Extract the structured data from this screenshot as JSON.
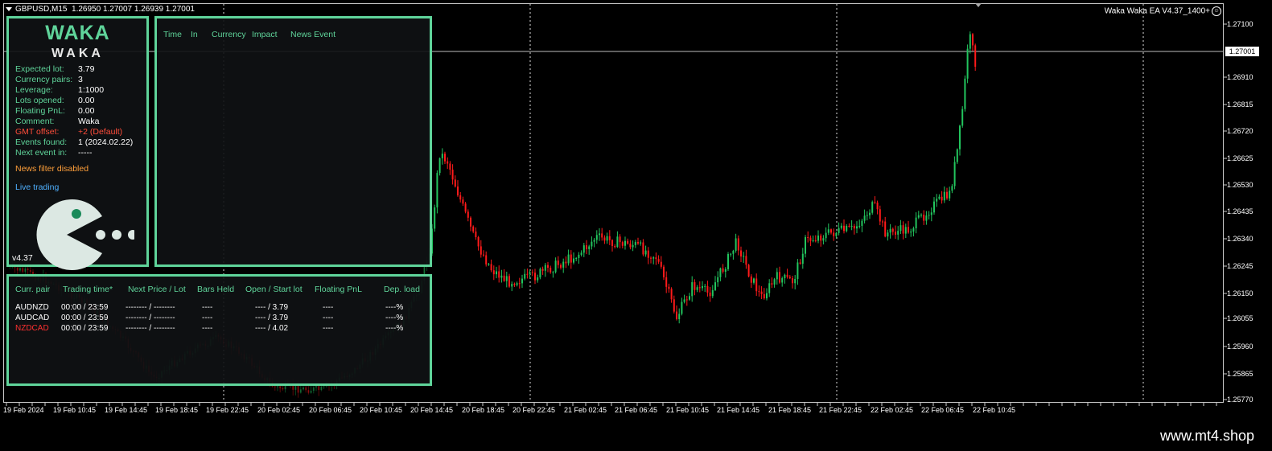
{
  "symbol_header": {
    "symbol": "GBPUSD,M15",
    "quotes": "1.26950 1.27007 1.26939 1.27001"
  },
  "ea_label": "Waka Waka EA V4.37_1400+",
  "current_price": "1.27001",
  "price_axis": [
    "1.27100",
    "1.26910",
    "1.26815",
    "1.26720",
    "1.26625",
    "1.26530",
    "1.26435",
    "1.26340",
    "1.26245",
    "1.26150",
    "1.26055",
    "1.25960",
    "1.25865",
    "1.25770"
  ],
  "time_axis": [
    "19 Feb 2024",
    "19 Feb 10:45",
    "19 Feb 14:45",
    "19 Feb 18:45",
    "19 Feb 22:45",
    "20 Feb 02:45",
    "20 Feb 06:45",
    "20 Feb 10:45",
    "20 Feb 14:45",
    "20 Feb 18:45",
    "20 Feb 22:45",
    "21 Feb 02:45",
    "21 Feb 06:45",
    "21 Feb 10:45",
    "21 Feb 14:45",
    "21 Feb 18:45",
    "21 Feb 22:45",
    "22 Feb 02:45",
    "22 Feb 06:45",
    "22 Feb 10:45"
  ],
  "colors": {
    "bull": "#22c55e",
    "bear": "#ff1a1a",
    "panel_border": "#5fd49a",
    "label": "#5fd49a",
    "warn": "#ff4d3a",
    "orange": "#ff9f3a",
    "blue": "#4fb0ff"
  },
  "info_panel": {
    "logo_top": "WAKA",
    "logo_bottom": "WAKA",
    "rows": [
      {
        "key": "Expected lot:",
        "value": "3.79"
      },
      {
        "key": "Currency pairs:",
        "value": "3"
      },
      {
        "key": "Leverage:",
        "value": "1:1000"
      },
      {
        "key": "Lots opened:",
        "value": "0.00"
      },
      {
        "key": "Floating PnL:",
        "value": "0.00"
      },
      {
        "key": "Comment:",
        "value": "Waka"
      },
      {
        "key": "GMT offset:",
        "value": "+2 (Default)"
      },
      {
        "key": "Events found:",
        "value": "1 (2024.02.22)"
      },
      {
        "key": "Next event in:",
        "value": "-----"
      }
    ],
    "news_filter": "News filter disabled",
    "live_trading": "Live trading",
    "version": "v4.37"
  },
  "news_panel": {
    "headers": [
      "Time",
      "In",
      "Currency",
      "Impact",
      "News Event"
    ]
  },
  "pairs_panel": {
    "headers": [
      "Curr. pair",
      "Trading time*",
      "Next Price / Lot",
      "Bars Held",
      "Open / Start lot",
      "Floating PnL",
      "Dep. load"
    ],
    "rows": [
      [
        "AUDNZD",
        "00:00 / 23:59",
        "-------- / --------",
        "----",
        "---- / 3.79",
        "----",
        "----%"
      ],
      [
        "AUDCAD",
        "00:00 / 23:59",
        "-------- / --------",
        "----",
        "---- / 3.79",
        "----",
        "----%"
      ],
      [
        "NZDCAD",
        "00:00 / 23:59",
        "-------- / --------",
        "----",
        "---- / 4.02",
        "----",
        "----%"
      ]
    ]
  },
  "watermark": "www.mt4.shop"
}
